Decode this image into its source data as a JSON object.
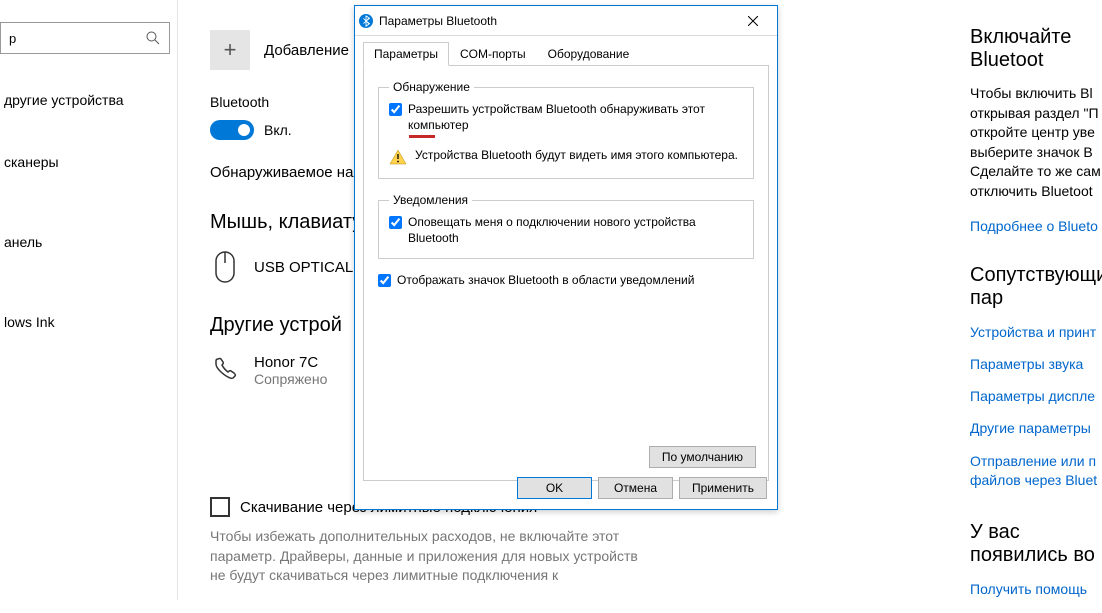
{
  "sidebar": {
    "search_placeholder": "р",
    "items": [
      "другие устройства",
      "сканеры",
      "анель",
      "lows Ink"
    ]
  },
  "main": {
    "add_device_label": "Добавление",
    "bluetooth_label": "Bluetooth",
    "toggle_state": "Вкл.",
    "discovery_text": "Обнаруживаемое на",
    "mouse_heading": "Мышь, клавиату",
    "mouse_device": "USB OPTICAL",
    "other_heading": "Другие устрой",
    "phone_device": "Honor 7C",
    "phone_status": "Сопряжено",
    "metered_label": "Скачивание через лимитные подключения",
    "metered_desc": "Чтобы избежать дополнительных расходов, не включайте этот параметр. Драйверы, данные и приложения для новых устройств не будут скачиваться через лимитные подключения к"
  },
  "right": {
    "enable_heading": "Включайте Bluetoot",
    "enable_desc": "Чтобы включить Bl открывая раздел \"П откройте центр уве выберите значок В Сделайте то же сам отключить Bluetoot",
    "more_link": "Подробнее о Blueto",
    "related_heading": "Сопутствующие пар",
    "link_devices": "Устройства и принт",
    "link_sound": "Параметры звука",
    "link_display": "Параметры диспле",
    "link_other": "Другие параметры",
    "link_send": "Отправление или п файлов через Bluet",
    "question_heading": "У вас появились во",
    "help_link": "Получить помощь"
  },
  "dialog": {
    "title": "Параметры Bluetooth",
    "tabs": [
      "Параметры",
      "COM-порты",
      "Оборудование"
    ],
    "group_discovery": "Обнаружение",
    "checkbox_discover": "Разрешить устройствам Bluetooth обнаруживать этот компьютер",
    "warn_text": "Устройства Bluetooth будут видеть имя этого компьютера.",
    "group_notify": "Уведомления",
    "checkbox_notify": "Оповещать меня о подключении нового устройства Bluetooth",
    "checkbox_tray": "Отображать значок Bluetooth в области уведомлений",
    "btn_default": "По умолчанию",
    "btn_ok": "OK",
    "btn_cancel": "Отмена",
    "btn_apply": "Применить"
  }
}
